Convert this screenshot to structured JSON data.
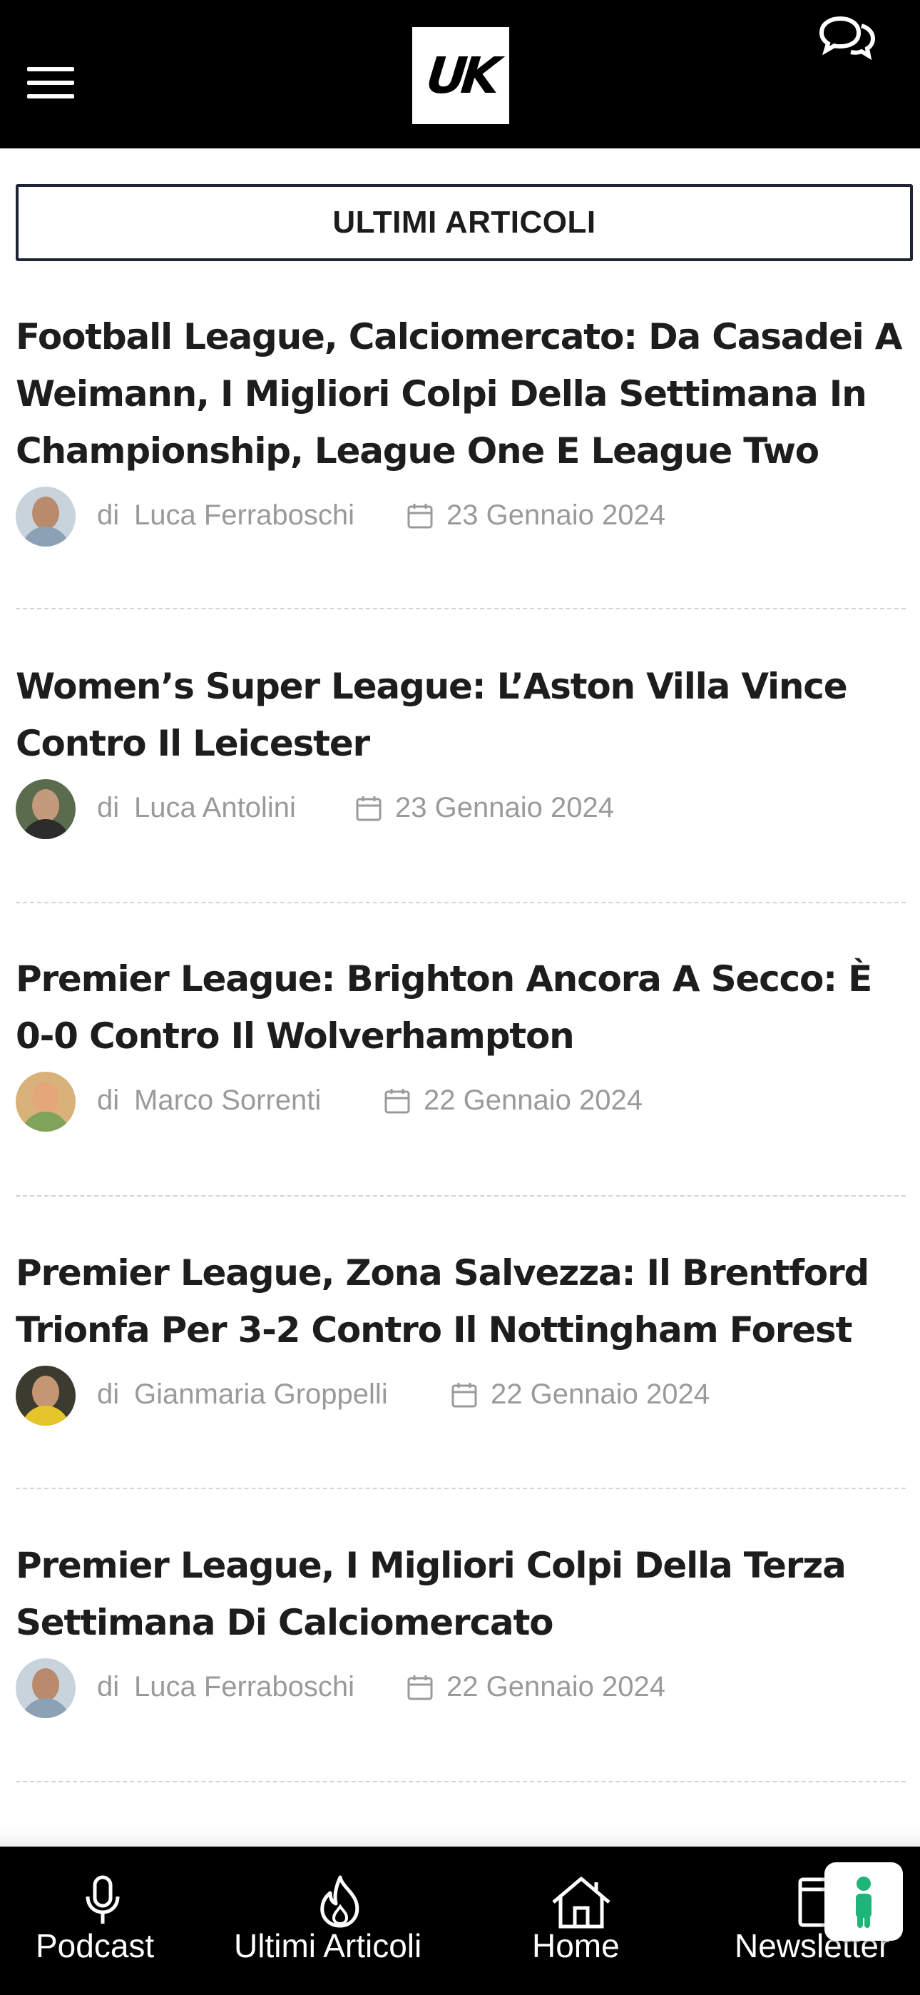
{
  "header": {
    "logo_text": "UK",
    "menu_icon": "hamburger-menu-icon",
    "chat_icon": "chat-bubbles-icon"
  },
  "section": {
    "title": "ULTIMI ARTICOLI"
  },
  "by_label": "di",
  "articles": [
    {
      "title": "Football League, Calciomercato: Da Casadei A Weimann, I Migliori Colpi Della Settimana In Championship, League One E League Two",
      "author": "Luca Ferraboschi",
      "date": "23 Gennaio 2024"
    },
    {
      "title": "Women’s Super League: L’Aston Villa Vince Contro Il Leicester",
      "author": "Luca Antolini",
      "date": "23 Gennaio 2024"
    },
    {
      "title": "Premier League: Brighton Ancora A Secco: È 0-0 Contro Il Wolverhampton",
      "author": "Marco Sorrenti",
      "date": "22 Gennaio 2024"
    },
    {
      "title": "Premier League, Zona Salvezza: Il Brentford Trionfa Per 3-2 Contro Il Nottingham Forest",
      "author": "Gianmaria Groppelli",
      "date": "22 Gennaio 2024"
    },
    {
      "title": "Premier League, I Migliori Colpi Della Terza Settimana Di Calciomercato",
      "author": "Luca Ferraboschi",
      "date": "22 Gennaio 2024"
    }
  ],
  "bottom_nav": [
    {
      "label": "Podcast",
      "icon": "microphone-icon"
    },
    {
      "label": "Ultimi Articoli",
      "icon": "flame-icon"
    },
    {
      "label": "Home",
      "icon": "home-icon"
    },
    {
      "label": "Newsletter",
      "icon": "newsletter-icon"
    }
  ],
  "floating_button": {
    "icon": "accessibility-icon",
    "color": "#1fb57a"
  },
  "colors": {
    "header_bg": "#000000",
    "meta_gray": "#9a9a9a",
    "title_text": "#1d1d1d"
  }
}
